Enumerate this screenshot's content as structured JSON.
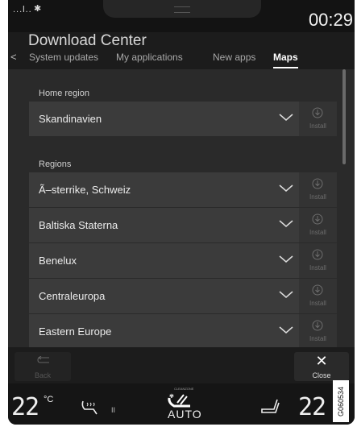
{
  "status": {
    "signal": "...l..",
    "bluetooth": "✱",
    "clock": "00:29"
  },
  "header": {
    "title": "Download Center",
    "back_chevron": "<",
    "tabs": [
      {
        "label": "System updates",
        "active": false
      },
      {
        "label": "My applications",
        "active": false
      },
      {
        "label": "New apps",
        "active": false
      },
      {
        "label": "Maps",
        "active": true
      }
    ]
  },
  "home_region": {
    "label": "Home region",
    "item": {
      "name": "Skandinavien",
      "install": "Install"
    }
  },
  "regions": {
    "label": "Regions",
    "items": [
      {
        "name": "Ã–sterrike, Schweiz",
        "install": "Install"
      },
      {
        "name": "Baltiska Staterna",
        "install": "Install"
      },
      {
        "name": "Benelux",
        "install": "Install"
      },
      {
        "name": "Centraleuropa",
        "install": "Install"
      },
      {
        "name": "Eastern Europe",
        "install": "Install"
      }
    ]
  },
  "buttons": {
    "back": "Back",
    "close_symbol": "✕",
    "close": "Close"
  },
  "climate": {
    "left_temp": "22",
    "left_unit": "°C",
    "seat_heat_level": "II",
    "auto_small": "CLEANZONE",
    "auto": "AUTO",
    "right_temp": "22"
  },
  "image_code": "G060534",
  "colors": {
    "background": "#1c1c1c",
    "list_row": "#3b3b3b",
    "install_disabled": "#6d6d6d",
    "active_tab": "#ffffff"
  },
  "icons": [
    "bluetooth-icon",
    "chevron-down-icon",
    "download-icon",
    "back-arrow-icon",
    "close-icon",
    "seat-heat-icon",
    "auto-climate-icon",
    "seat-icon"
  ]
}
